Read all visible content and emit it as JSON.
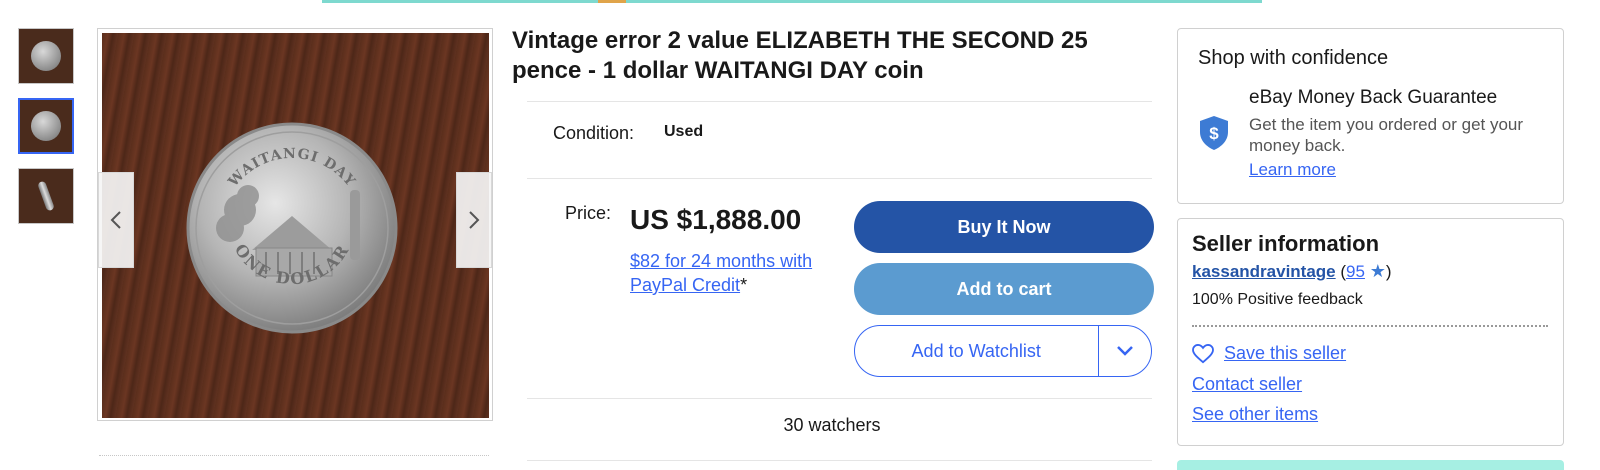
{
  "listing": {
    "title": "Vintage error 2 value ELIZABETH THE SECOND 25 pence - 1 dollar WAITANGI DAY coin",
    "condition_label": "Condition:",
    "condition_value": "Used",
    "price_label": "Price:",
    "price_value": "US $1,888.00",
    "credit_link": "$82 for 24 months with PayPal Credit",
    "credit_asterisk": "*",
    "watchers": "30 watchers"
  },
  "gallery": {
    "thumbnails": [
      "coin-front-thumbnail",
      "coin-back-thumbnail",
      "coin-edge-thumbnail"
    ],
    "selected_index": 1,
    "coin_top_text": "WAITANGI DAY",
    "coin_bottom_text": "ONE DOLLAR"
  },
  "actions": {
    "buy_now": "Buy It Now",
    "add_to_cart": "Add to cart",
    "add_to_watchlist": "Add to Watchlist"
  },
  "confidence": {
    "title": "Shop with confidence",
    "guarantee_title": "eBay Money Back Guarantee",
    "guarantee_text": "Get the item you ordered or get your money back.",
    "learn_more": "Learn more",
    "shield_symbol": "$"
  },
  "seller": {
    "title": "Seller information",
    "name": "kassandravintage",
    "open_paren": " (",
    "score": "95",
    "star": "★",
    "close_paren": ")",
    "feedback": "100% Positive feedback",
    "save": "Save this seller",
    "contact": "Contact seller",
    "other_items": "See other items"
  },
  "colors": {
    "buy_button": "#2454a6",
    "cart_button": "#5b9bd0",
    "link": "#3665f3",
    "banner_teal": "#7ed9cf"
  },
  "icons": {
    "prev": "chevron-left-icon",
    "next": "chevron-right-icon",
    "watchlist_menu": "chevron-down-icon",
    "guarantee": "shield-dollar-icon",
    "save_seller": "heart-icon",
    "seller_badge": "star-icon"
  }
}
